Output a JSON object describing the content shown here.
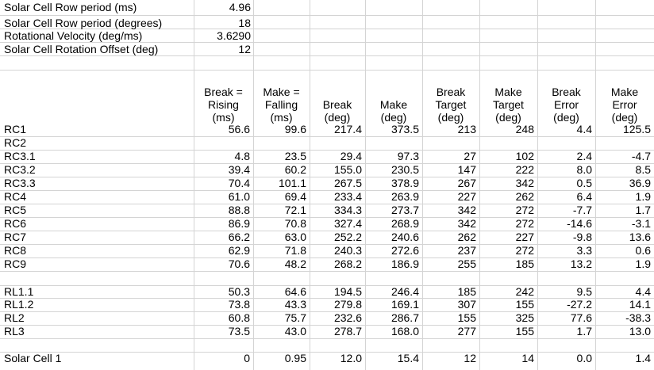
{
  "params": [
    {
      "label": "Solar Cell Row period (ms)",
      "value": "4.96"
    },
    {
      "label": "Solar Cell Row period (degrees)",
      "value": "18"
    },
    {
      "label": "Rotational Velocity (deg/ms)",
      "value": "3.6290"
    },
    {
      "label": "Solar Cell Rotation Offset (deg)",
      "value": "12"
    }
  ],
  "headers": [
    {
      "lines": [
        "Break =",
        "Rising",
        "(ms)"
      ]
    },
    {
      "lines": [
        "Make =",
        "Falling",
        "(ms)"
      ]
    },
    {
      "lines": [
        "Break",
        "(deg)"
      ]
    },
    {
      "lines": [
        "Make",
        "(deg)"
      ]
    },
    {
      "lines": [
        "Break",
        "Target",
        "(deg)"
      ]
    },
    {
      "lines": [
        "Make",
        "Target",
        "(deg)"
      ]
    },
    {
      "lines": [
        "Break",
        "Error",
        "(deg)"
      ]
    },
    {
      "lines": [
        "Make",
        "Error",
        "(deg)"
      ]
    }
  ],
  "rows": [
    {
      "label": "RC1",
      "cells": [
        "56.6",
        "99.6",
        "217.4",
        "373.5",
        "213",
        "248",
        "4.4",
        "125.5"
      ]
    },
    {
      "label": "RC2",
      "cells": [
        "",
        "",
        "",
        "",
        "",
        "",
        "",
        ""
      ]
    },
    {
      "label": "RC3.1",
      "cells": [
        "4.8",
        "23.5",
        "29.4",
        "97.3",
        "27",
        "102",
        "2.4",
        "-4.7"
      ]
    },
    {
      "label": "RC3.2",
      "cells": [
        "39.4",
        "60.2",
        "155.0",
        "230.5",
        "147",
        "222",
        "8.0",
        "8.5"
      ]
    },
    {
      "label": "RC3.3",
      "cells": [
        "70.4",
        "101.1",
        "267.5",
        "378.9",
        "267",
        "342",
        "0.5",
        "36.9"
      ]
    },
    {
      "label": "RC4",
      "cells": [
        "61.0",
        "69.4",
        "233.4",
        "263.9",
        "227",
        "262",
        "6.4",
        "1.9"
      ]
    },
    {
      "label": "RC5",
      "cells": [
        "88.8",
        "72.1",
        "334.3",
        "273.7",
        "342",
        "272",
        "-7.7",
        "1.7"
      ]
    },
    {
      "label": "RC6",
      "cells": [
        "86.9",
        "70.8",
        "327.4",
        "268.9",
        "342",
        "272",
        "-14.6",
        "-3.1"
      ]
    },
    {
      "label": "RC7",
      "cells": [
        "66.2",
        "63.0",
        "252.2",
        "240.6",
        "262",
        "227",
        "-9.8",
        "13.6"
      ]
    },
    {
      "label": "RC8",
      "cells": [
        "62.9",
        "71.8",
        "240.3",
        "272.6",
        "237",
        "272",
        "3.3",
        "0.6"
      ]
    },
    {
      "label": "RC9",
      "cells": [
        "70.6",
        "48.2",
        "268.2",
        "186.9",
        "255",
        "185",
        "13.2",
        "1.9"
      ]
    },
    {
      "label": "",
      "cells": [
        "",
        "",
        "",
        "",
        "",
        "",
        "",
        ""
      ]
    },
    {
      "label": "RL1.1",
      "cells": [
        "50.3",
        "64.6",
        "194.5",
        "246.4",
        "185",
        "242",
        "9.5",
        "4.4"
      ]
    },
    {
      "label": "RL1.2",
      "cells": [
        "73.8",
        "43.3",
        "279.8",
        "169.1",
        "307",
        "155",
        "-27.2",
        "14.1"
      ]
    },
    {
      "label": "RL2",
      "cells": [
        "60.8",
        "75.7",
        "232.6",
        "286.7",
        "155",
        "325",
        "77.6",
        "-38.3"
      ]
    },
    {
      "label": "RL3",
      "cells": [
        "73.5",
        "43.0",
        "278.7",
        "168.0",
        "277",
        "155",
        "1.7",
        "13.0"
      ]
    },
    {
      "label": "",
      "cells": [
        "",
        "",
        "",
        "",
        "",
        "",
        "",
        ""
      ]
    },
    {
      "label": "Solar Cell 1",
      "cells": [
        "0",
        "0.95",
        "12.0",
        "15.4",
        "12",
        "14",
        "0.0",
        "1.4"
      ]
    }
  ]
}
